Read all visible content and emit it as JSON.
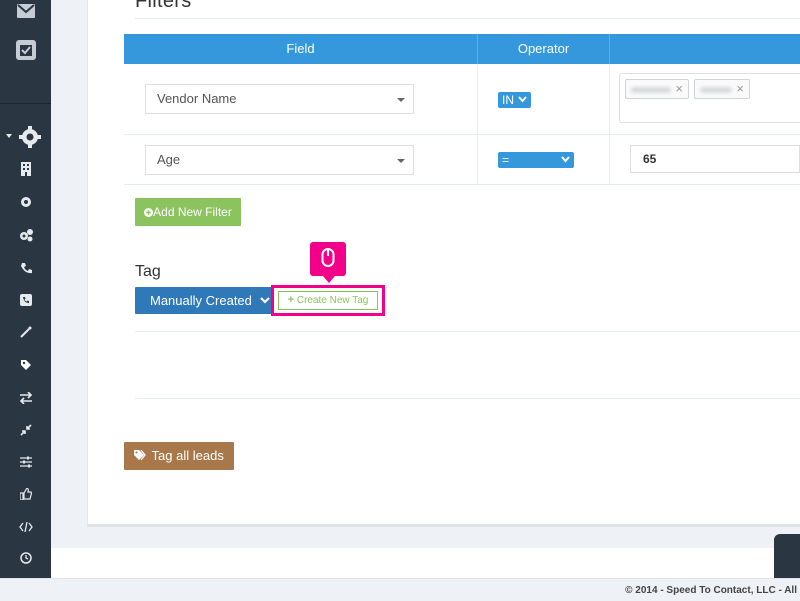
{
  "filters": {
    "title": "Filters",
    "columns": [
      "Field",
      "Operator",
      ""
    ],
    "rows": [
      {
        "field": "Vendor Name",
        "operator": "IN",
        "value_chips": [
          "",
          ""
        ]
      },
      {
        "field": "Age",
        "operator": "=",
        "value": "65"
      }
    ],
    "add_filter_label": "Add New Filter"
  },
  "tag": {
    "label": "Tag",
    "selected": "Manually Created",
    "create_label": "Create New Tag"
  },
  "actions": {
    "tag_all_label": "Tag all leads"
  },
  "footer": {
    "text": "© 2014 - Speed To Contact, LLC - All"
  },
  "sidebar": {
    "icons": [
      "envelope-icon",
      "calendar-check-icon",
      "gear-icon",
      "building-icon",
      "cog-icon",
      "cogs-icon",
      "phone-icon",
      "phone-square-icon",
      "magic-wand-icon",
      "tag-icon",
      "exchange-icon",
      "compress-icon",
      "sliders-icon",
      "thumbs-up-icon",
      "code-icon",
      "clock-icon"
    ]
  },
  "colors": {
    "sidebar": "#2b3643",
    "table_header": "#3598dc",
    "add_filter": "#8bc35f",
    "tag_select": "#3079b9",
    "tag_all": "#a8784a",
    "highlight": "#f2008a"
  }
}
